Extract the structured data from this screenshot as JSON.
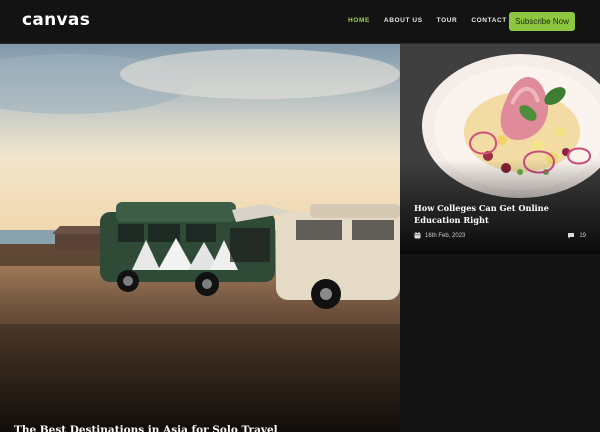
{
  "header": {
    "logo": "canvas",
    "nav": [
      "HOME",
      "ABOUT US",
      "TOUR",
      "CONTACT US"
    ],
    "subscribe_label": "Subscribe Now",
    "active_nav": "HOME"
  },
  "hero": {
    "title": "The Best Destinations in Asia for Solo Travel"
  },
  "featured_card": {
    "title": "How Colleges Can Get Online Education Right",
    "date": "16th Feb, 2023",
    "comments": "19"
  },
  "colors": {
    "accent": "#8dc63f",
    "nav_active": "#9fd24f",
    "background": "#141414"
  },
  "icons": {
    "calendar": "calendar-icon",
    "comment": "comment-icon"
  }
}
